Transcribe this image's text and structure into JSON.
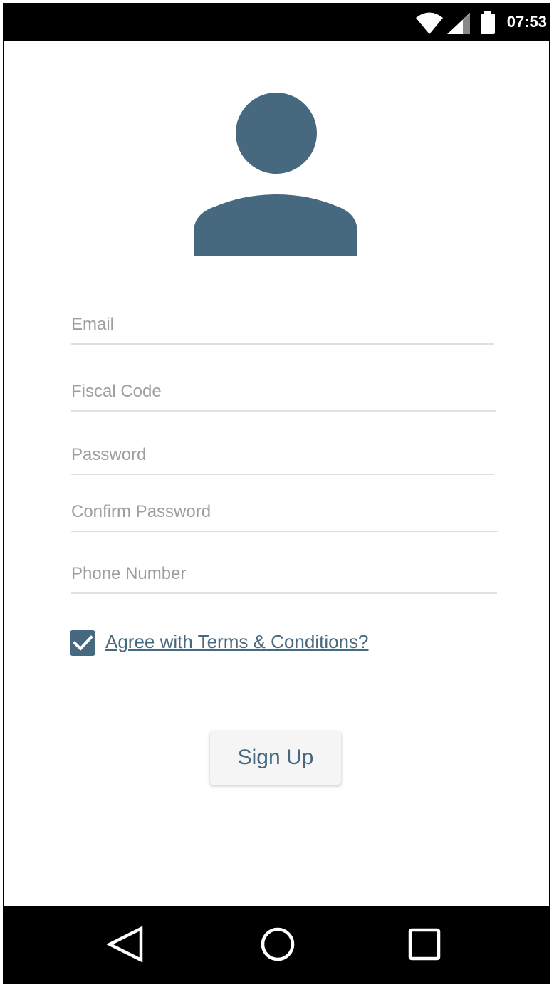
{
  "status_bar": {
    "time": "07:53",
    "wifi_icon": "wifi-icon",
    "signal_icon": "cell-signal-icon",
    "battery_icon": "battery-icon"
  },
  "profile": {
    "avatar_icon": "user-avatar-icon",
    "avatar_color": "#46697f"
  },
  "form": {
    "email_placeholder": "Email",
    "fiscal_code_placeholder": "Fiscal Code",
    "password_placeholder": "Password",
    "confirm_password_placeholder": "Confirm Password",
    "phone_placeholder": "Phone Number",
    "terms_checked": true,
    "terms_label": "Agree with Terms & Conditions?",
    "signup_label": "Sign Up"
  },
  "nav_bar": {
    "back_icon": "back-triangle-icon",
    "home_icon": "home-circle-icon",
    "recents_icon": "recents-square-icon"
  },
  "colors": {
    "accent": "#46697f",
    "placeholder": "#9e9e9e",
    "underline": "#e0e0e0",
    "button_bg": "#f5f5f5"
  }
}
